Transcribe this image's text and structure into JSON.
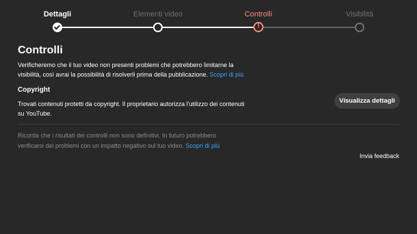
{
  "stepper": {
    "steps": [
      {
        "label": "Dettagli",
        "state": "done"
      },
      {
        "label": "Elementi video",
        "state": "done"
      },
      {
        "label": "Controlli",
        "state": "current-warning"
      },
      {
        "label": "Visibilità",
        "state": "pending"
      }
    ]
  },
  "checks": {
    "title": "Controlli",
    "intro": "Verificheremo che il tuo video non presenti problemi che potrebbero limitarne la visibilità, così avrai la possibilità di risolverli prima della pubblicazione.",
    "learn_more": "Scopri di più"
  },
  "copyright": {
    "title": "Copyright",
    "body": "Trovati contenuti protetti da copyright. Il proprietario autorizza l'utilizzo dei contenuti su YouTube.",
    "details_button": "Visualizza dettagli"
  },
  "disclaimer": {
    "text": "Ricorda che i risultati dei controlli non sono definitivi. In futuro potrebbero verificarsi dei problemi con un impatto negativo sul tuo video.",
    "learn_more": "Scopri di più"
  },
  "feedback_link": "Invia feedback",
  "colors": {
    "background": "#282828",
    "warning": "#ff8a80",
    "link": "#3ea6ff",
    "button_bg": "#3f3f3f"
  },
  "icons": [
    "check-icon",
    "warning-icon"
  ]
}
